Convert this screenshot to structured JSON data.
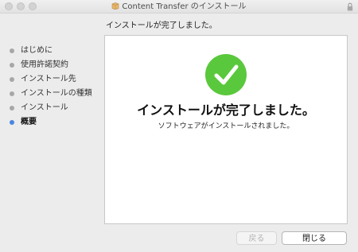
{
  "window": {
    "title": "Content Transfer のインストール",
    "icons": {
      "title_icon": "package-icon",
      "lock_icon": "lock-icon"
    }
  },
  "step_title": "インストールが完了しました。",
  "sidebar": {
    "items": [
      {
        "label": "はじめに",
        "state": "done"
      },
      {
        "label": "使用許諾契約",
        "state": "done"
      },
      {
        "label": "インストール先",
        "state": "done"
      },
      {
        "label": "インストールの種類",
        "state": "done"
      },
      {
        "label": "インストール",
        "state": "done"
      },
      {
        "label": "概要",
        "state": "active"
      }
    ]
  },
  "content": {
    "icon": "checkmark-circle-icon",
    "heading": "インストールが完了しました。",
    "subtext": "ソフトウェアがインストールされました。"
  },
  "buttons": {
    "back_label": "戻る",
    "close_label": "閉じる"
  },
  "colors": {
    "success_green": "#5ac83c",
    "active_dot": "#4a86e0",
    "inactive_dot": "#a7a7a7"
  }
}
